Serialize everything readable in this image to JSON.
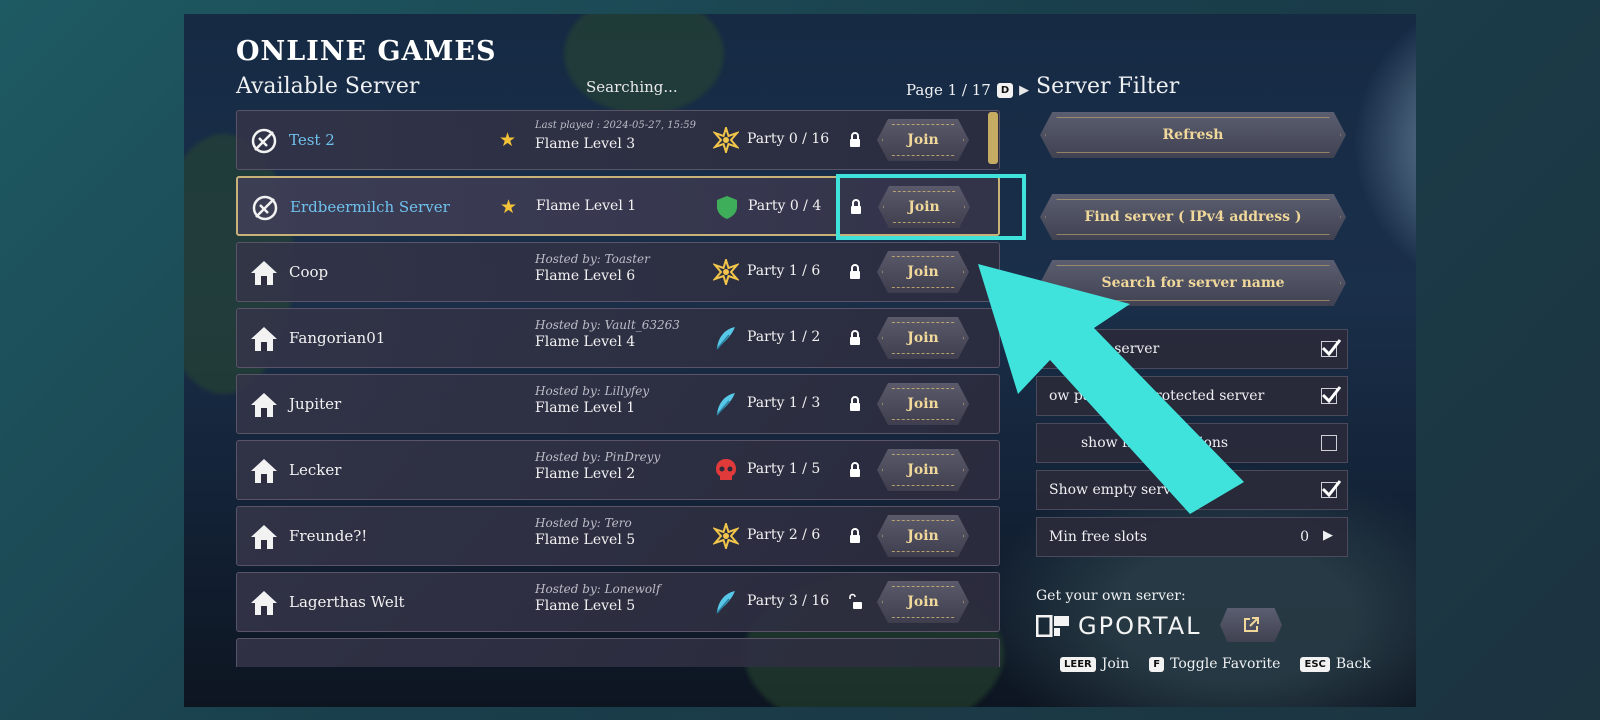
{
  "header": {
    "title": "ONLINE GAMES",
    "subtitle": "Available Server",
    "status": "Searching...",
    "page": "Page 1 / 17",
    "page_key": "D"
  },
  "servers": [
    {
      "name": "Test 2",
      "favorite": true,
      "meta": "Last played : 2024-05-27, 15:59",
      "flame": "Flame Level 3",
      "type_icon": "sun-icon",
      "party": "Party 0 / 16",
      "lock": "locked",
      "join": "Join"
    },
    {
      "name": "Erdbeermilch Server",
      "favorite": true,
      "meta": "",
      "flame": "Flame Level 1",
      "type_icon": "shield-icon",
      "party": "Party 0 / 4",
      "lock": "locked",
      "join": "Join"
    },
    {
      "name": "Coop",
      "favorite": false,
      "meta": "Hosted by: Toaster",
      "flame": "Flame Level 6",
      "type_icon": "sun-icon",
      "party": "Party 1 / 6",
      "lock": "locked",
      "join": "Join"
    },
    {
      "name": "Fangorian01",
      "favorite": false,
      "meta": "Hosted by: Vault_63263",
      "flame": "Flame Level 4",
      "type_icon": "feather-icon",
      "party": "Party 1 / 2",
      "lock": "locked",
      "join": "Join"
    },
    {
      "name": "Jupiter",
      "favorite": false,
      "meta": "Hosted by: Lillyfey",
      "flame": "Flame Level 1",
      "type_icon": "feather-icon",
      "party": "Party 1 / 3",
      "lock": "locked",
      "join": "Join"
    },
    {
      "name": "Lecker",
      "favorite": false,
      "meta": "Hosted by: PinDreyy",
      "flame": "Flame Level 2",
      "type_icon": "skull-icon",
      "party": "Party 1 / 5",
      "lock": "locked",
      "join": "Join"
    },
    {
      "name": "Freunde?!",
      "favorite": false,
      "meta": "Hosted by: Tero",
      "flame": "Flame Level 5",
      "type_icon": "sun-icon",
      "party": "Party 2 / 6",
      "lock": "locked",
      "join": "Join"
    },
    {
      "name": "Lagerthas Welt",
      "favorite": false,
      "meta": "Hosted by: Lonewolf",
      "flame": "Flame Level 5",
      "type_icon": "feather-icon",
      "party": "Party 3 / 16",
      "lock": "unlocked",
      "join": "Join"
    }
  ],
  "filter": {
    "title": "Server Filter",
    "refresh": "Refresh",
    "find_ip": "Find server ( IPv4 address )",
    "search_name": "Search for server name",
    "options": [
      {
        "label": "edicated server",
        "checked": true
      },
      {
        "label": "ow password protected server",
        "checked": true
      },
      {
        "label": "show friend sessions",
        "checked": false
      },
      {
        "label": "Show empty server",
        "checked": true
      }
    ],
    "min_slots_label": "Min free slots",
    "min_slots_value": "0"
  },
  "promo": {
    "label": "Get your own server:",
    "brand": "GPORTAL"
  },
  "hints": [
    {
      "key": "LEER",
      "label": "Join"
    },
    {
      "key": "F",
      "label": "Toggle Favorite"
    },
    {
      "key": "ESC",
      "label": "Back"
    }
  ],
  "colors": {
    "accent_cyan": "#3fe3dc",
    "gold": "#f0d79a",
    "server_blue": "#6fc2ee",
    "star": "#f4c238"
  }
}
